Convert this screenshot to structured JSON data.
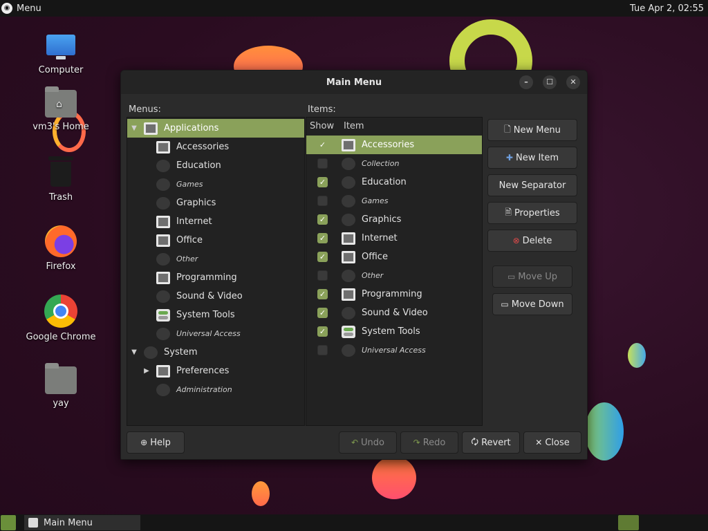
{
  "topbar": {
    "menu_label": "Menu",
    "clock": "Tue Apr  2, 02:55"
  },
  "desktop": {
    "icons": [
      {
        "label": "Computer"
      },
      {
        "label": "vm3's Home"
      },
      {
        "label": "Trash"
      },
      {
        "label": "Firefox"
      },
      {
        "label": "Google Chrome"
      },
      {
        "label": "yay"
      }
    ]
  },
  "window": {
    "title": "Main Menu",
    "menus_label": "Menus:",
    "items_label": "Items:",
    "menus_tree": [
      {
        "label": "Applications",
        "level": 0,
        "expander": "▼",
        "italic": false,
        "selected": true
      },
      {
        "label": "Accessories",
        "level": 1,
        "italic": false
      },
      {
        "label": "Education",
        "level": 1,
        "italic": false
      },
      {
        "label": "Games",
        "level": 1,
        "italic": true
      },
      {
        "label": "Graphics",
        "level": 1,
        "italic": false
      },
      {
        "label": "Internet",
        "level": 1,
        "italic": false
      },
      {
        "label": "Office",
        "level": 1,
        "italic": false
      },
      {
        "label": "Other",
        "level": 1,
        "italic": true
      },
      {
        "label": "Programming",
        "level": 1,
        "italic": false
      },
      {
        "label": "Sound & Video",
        "level": 1,
        "italic": false
      },
      {
        "label": "System Tools",
        "level": 1,
        "italic": false
      },
      {
        "label": "Universal Access",
        "level": 1,
        "italic": true
      },
      {
        "label": "System",
        "level": 0,
        "expander": "▼",
        "italic": false
      },
      {
        "label": "Preferences",
        "level": 1,
        "expander": "▶",
        "italic": false
      },
      {
        "label": "Administration",
        "level": 1,
        "italic": true
      }
    ],
    "items_headers": {
      "show": "Show",
      "item": "Item"
    },
    "items_list": [
      {
        "label": "Accessories",
        "checked": true,
        "italic": false,
        "selected": true
      },
      {
        "label": "Collection",
        "checked": false,
        "italic": true
      },
      {
        "label": "Education",
        "checked": true,
        "italic": false
      },
      {
        "label": "Games",
        "checked": false,
        "italic": true
      },
      {
        "label": "Graphics",
        "checked": true,
        "italic": false
      },
      {
        "label": "Internet",
        "checked": true,
        "italic": false
      },
      {
        "label": "Office",
        "checked": true,
        "italic": false
      },
      {
        "label": "Other",
        "checked": false,
        "italic": true
      },
      {
        "label": "Programming",
        "checked": true,
        "italic": false
      },
      {
        "label": "Sound & Video",
        "checked": true,
        "italic": false
      },
      {
        "label": "System Tools",
        "checked": true,
        "italic": false
      },
      {
        "label": "Universal Access",
        "checked": false,
        "italic": true
      }
    ],
    "side_buttons": {
      "new_menu": "New Menu",
      "new_item": "New Item",
      "new_separator": "New Separator",
      "properties": "Properties",
      "delete": "Delete",
      "move_up": "Move Up",
      "move_down": "Move Down"
    },
    "bottom_buttons": {
      "help": "Help",
      "undo": "Undo",
      "redo": "Redo",
      "revert": "Revert",
      "close": "Close"
    },
    "accent_color": "#8aa15a"
  },
  "taskbar": {
    "task_label": "Main Menu"
  }
}
